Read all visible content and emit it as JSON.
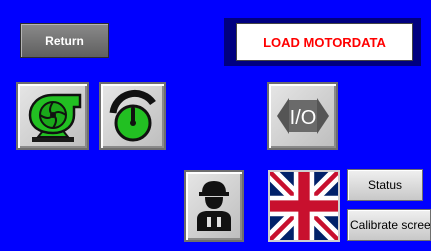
{
  "header": {
    "return_label": "Return",
    "title": "LOAD MOTORDATA"
  },
  "icons": {
    "pump": "pump-icon",
    "gauge": "gauge-icon",
    "io": "io-toggle-icon",
    "operator": "operator-icon",
    "flag": "uk-flag-icon"
  },
  "io_label": "I/O",
  "buttons": {
    "status_label": "Status",
    "calibrate_label": "Calibrate screen"
  },
  "colors": {
    "background": "#0000ff",
    "title_text": "#ff0000",
    "icon_green": "#22c022"
  }
}
